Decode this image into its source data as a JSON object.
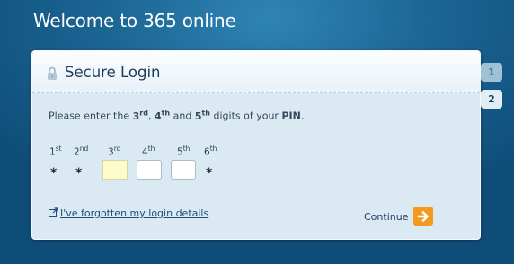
{
  "header": {
    "title": "Welcome to 365 online"
  },
  "login": {
    "title": "Secure Login",
    "instruction": {
      "prefix": "Please enter the ",
      "d1": "3",
      "d1_suffix": "rd",
      "sep1": ", ",
      "d2": "4",
      "d2_suffix": "th",
      "sep2": " and ",
      "d3": "5",
      "d3_suffix": "th",
      "middle": " digits of your ",
      "pin": "PIN",
      "end": "."
    },
    "digits": [
      {
        "num": "1",
        "suffix": "st",
        "state": "masked",
        "display": "*"
      },
      {
        "num": "2",
        "suffix": "nd",
        "state": "masked",
        "display": "*"
      },
      {
        "num": "3",
        "suffix": "rd",
        "state": "input",
        "value": ""
      },
      {
        "num": "4",
        "suffix": "th",
        "state": "input",
        "value": ""
      },
      {
        "num": "5",
        "suffix": "th",
        "state": "input",
        "value": ""
      },
      {
        "num": "6",
        "suffix": "th",
        "state": "masked",
        "display": "*"
      }
    ],
    "forgot_link": "I've forgotten my login details",
    "continue_label": "Continue"
  },
  "steps": [
    {
      "label": "1",
      "state": "inactive"
    },
    {
      "label": "2",
      "state": "active"
    }
  ],
  "colors": {
    "accent": "#f29a1e",
    "link": "#1d4d78",
    "active_field": "#fffccc"
  },
  "icons": [
    "lock-icon",
    "external-link-icon",
    "arrow-right-icon"
  ]
}
